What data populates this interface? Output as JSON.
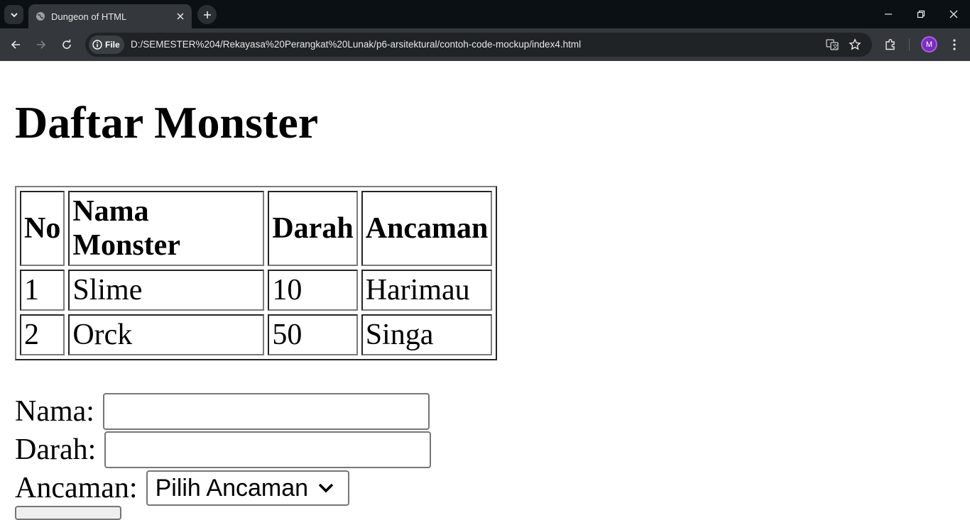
{
  "browser": {
    "tab_title": "Dungeon of HTML",
    "site_chip_label": "File",
    "url": "D:/SEMESTER%204/Rekayasa%20Perangkat%20Lunak/p6-arsitektural/contoh-code-mockup/index4.html",
    "profile_initial": "M",
    "accent_color": "#7b2cbf"
  },
  "page": {
    "title": "Daftar Monster",
    "table": {
      "headers": [
        "No",
        "Nama Monster",
        "Darah",
        "Ancaman"
      ],
      "rows": [
        [
          "1",
          "Slime",
          "10",
          "Harimau"
        ],
        [
          "2",
          "Orck",
          "50",
          "Singa"
        ]
      ]
    },
    "form": {
      "nama_label": "Nama:",
      "nama_value": "",
      "darah_label": "Darah:",
      "darah_value": "",
      "ancaman_label": "Ancaman:",
      "ancaman_selected": "Pilih Ancaman"
    }
  },
  "icons": [
    "tab-search-icon",
    "globe-icon",
    "close-icon",
    "plus-icon",
    "minimize-icon",
    "restore-icon",
    "back-icon",
    "forward-icon",
    "reload-icon",
    "info-icon",
    "translate-icon",
    "star-icon",
    "extensions-icon",
    "more-icon",
    "chevron-down-icon"
  ]
}
